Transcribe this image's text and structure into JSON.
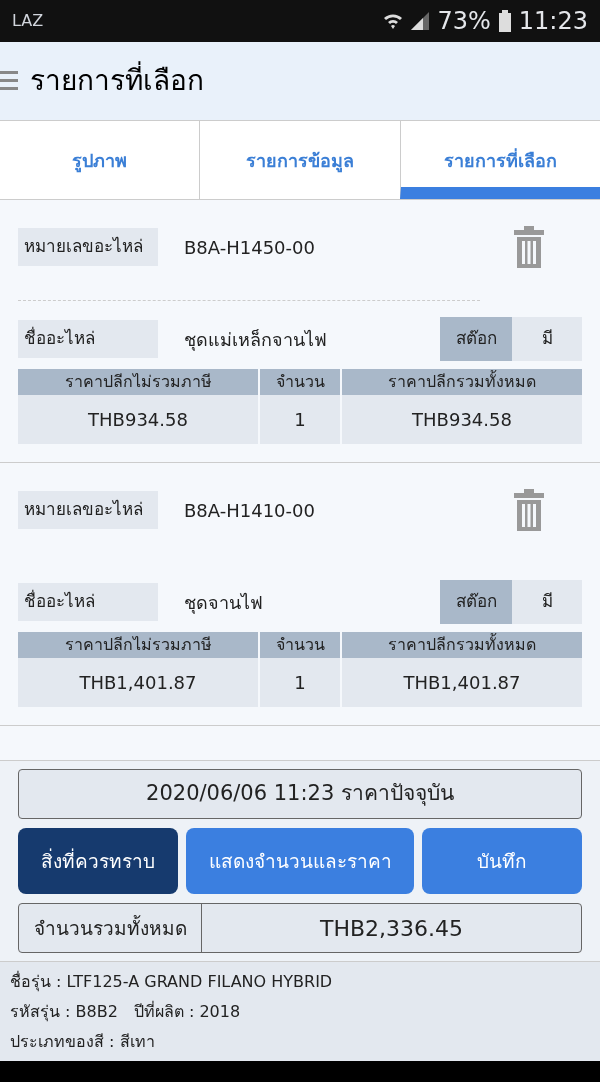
{
  "status_bar": {
    "carrier": "LAZ",
    "battery": "73%",
    "time": "11:23"
  },
  "header": {
    "title": "รายการที่เลือก"
  },
  "tabs": [
    {
      "label": "รูปภาพ",
      "selected": false
    },
    {
      "label": "รายการข้อมูล",
      "selected": false
    },
    {
      "label": "รายการที่เลือก",
      "selected": true
    }
  ],
  "items": [
    {
      "part_no_label": "หมายเลขอะไหล่",
      "part_no": "B8A-H1450-00",
      "name_label": "ชื่ออะไหล่",
      "name": "ชุดแม่เหล็กจานไฟ",
      "stock_label": "สต๊อก",
      "stock": "มี",
      "columns": [
        "ราคาปลีกไม่รวมภาษี",
        "จำนวน",
        "ราคาปลีกรวมทั้งหมด"
      ],
      "values": [
        "THB934.58",
        "1",
        "THB934.58"
      ]
    },
    {
      "part_no_label": "หมายเลขอะไหล่",
      "part_no": "B8A-H1410-00",
      "name_label": "ชื่ออะไหล่",
      "name": "ชุดจานไฟ",
      "stock_label": "สต๊อก",
      "stock": "มี",
      "columns": [
        "ราคาปลีกไม่รวมภาษี",
        "จำนวน",
        "ราคาปลีกรวมทั้งหมด"
      ],
      "values": [
        "THB1,401.87",
        "1",
        "THB1,401.87"
      ]
    }
  ],
  "price_date": "2020/06/06 11:23 ราคาปัจจุบัน",
  "buttons": [
    {
      "label": "สิ่งที่ควรทราบ",
      "kind": "dark"
    },
    {
      "label": "แสดงจำนวนและราคา",
      "kind": "blue"
    },
    {
      "label": "บันทึก",
      "kind": "blue"
    }
  ],
  "total": {
    "label": "จำนวนรวมทั้งหมด",
    "value": "THB2,336.45"
  },
  "info": [
    "ชื่อรุ่น : LTF125-A GRAND FILANO HYBRID",
    "รหัสรุ่น : B8B2",
    "ปีที่ผลิต : 2018",
    "ประเภทของสี : สีเทา"
  ]
}
